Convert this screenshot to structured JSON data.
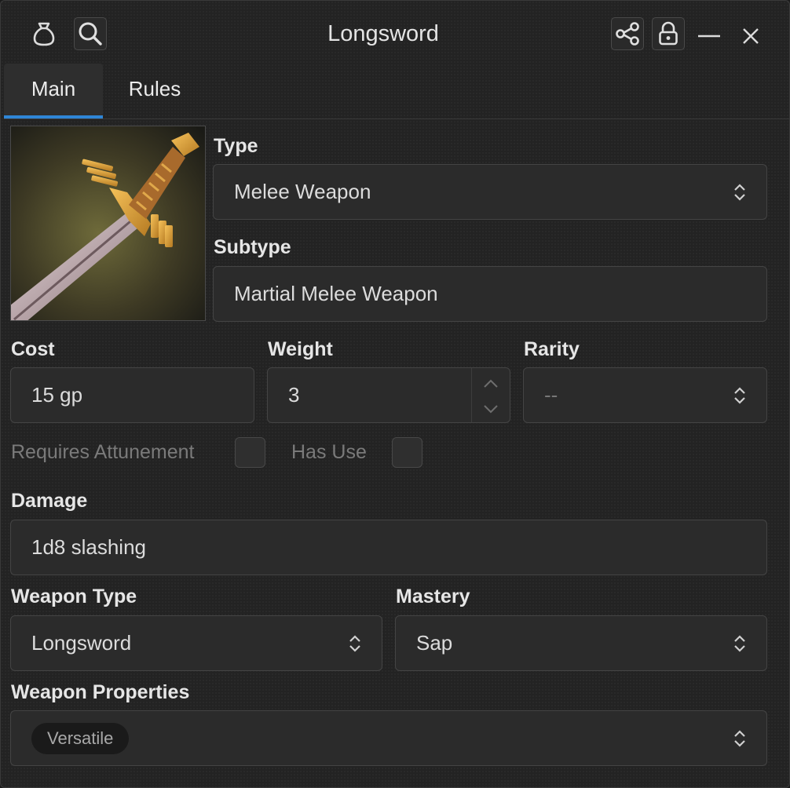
{
  "window": {
    "title": "Longsword",
    "icons": {
      "bag": "bag-icon",
      "search": "search-icon",
      "share": "share-icon",
      "lock": "lock-icon",
      "minimize": "minimize-icon",
      "close": "close-icon"
    }
  },
  "tabs": [
    {
      "label": "Main",
      "active": true
    },
    {
      "label": "Rules",
      "active": false
    }
  ],
  "item": {
    "image": "longsword-artwork",
    "type": {
      "label": "Type",
      "value": "Melee Weapon"
    },
    "subtype": {
      "label": "Subtype",
      "value": "Martial Melee Weapon"
    },
    "cost": {
      "label": "Cost",
      "value": "15 gp"
    },
    "weight": {
      "label": "Weight",
      "value": "3"
    },
    "rarity": {
      "label": "Rarity",
      "value": "--"
    },
    "requires_attunement": {
      "label": "Requires Attunement",
      "checked": false
    },
    "has_use": {
      "label": "Has Use",
      "checked": false
    },
    "damage": {
      "label": "Damage",
      "value": "1d8 slashing"
    },
    "weapon_type": {
      "label": "Weapon Type",
      "value": "Longsword"
    },
    "mastery": {
      "label": "Mastery",
      "value": "Sap"
    },
    "weapon_properties": {
      "label": "Weapon Properties",
      "chips": [
        "Versatile"
      ]
    }
  },
  "colors": {
    "accent": "#2f86d6",
    "background": "#232323",
    "field": "#2b2b2b"
  }
}
